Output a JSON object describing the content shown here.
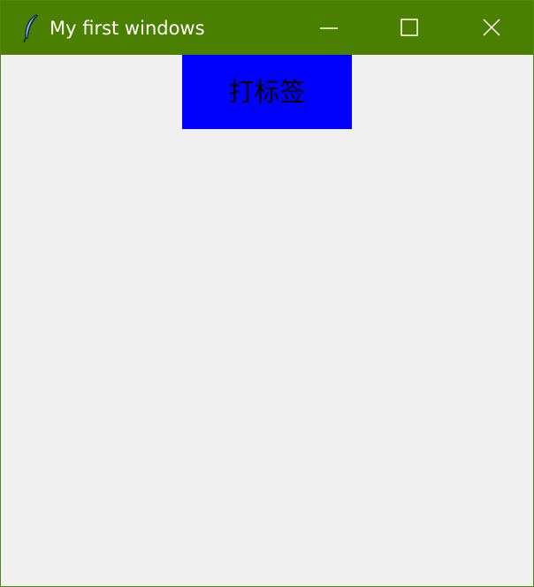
{
  "window": {
    "title": "My first windows",
    "app_icon": "feather-icon",
    "controls": {
      "minimize": "minimize-icon",
      "maximize": "maximize-icon",
      "close": "close-icon"
    },
    "accent_color": "#4a7f00",
    "background_color": "#f0f0f0"
  },
  "content": {
    "label": {
      "text": "打标签",
      "background_color": "#0000ff",
      "text_color": "#000000"
    }
  }
}
